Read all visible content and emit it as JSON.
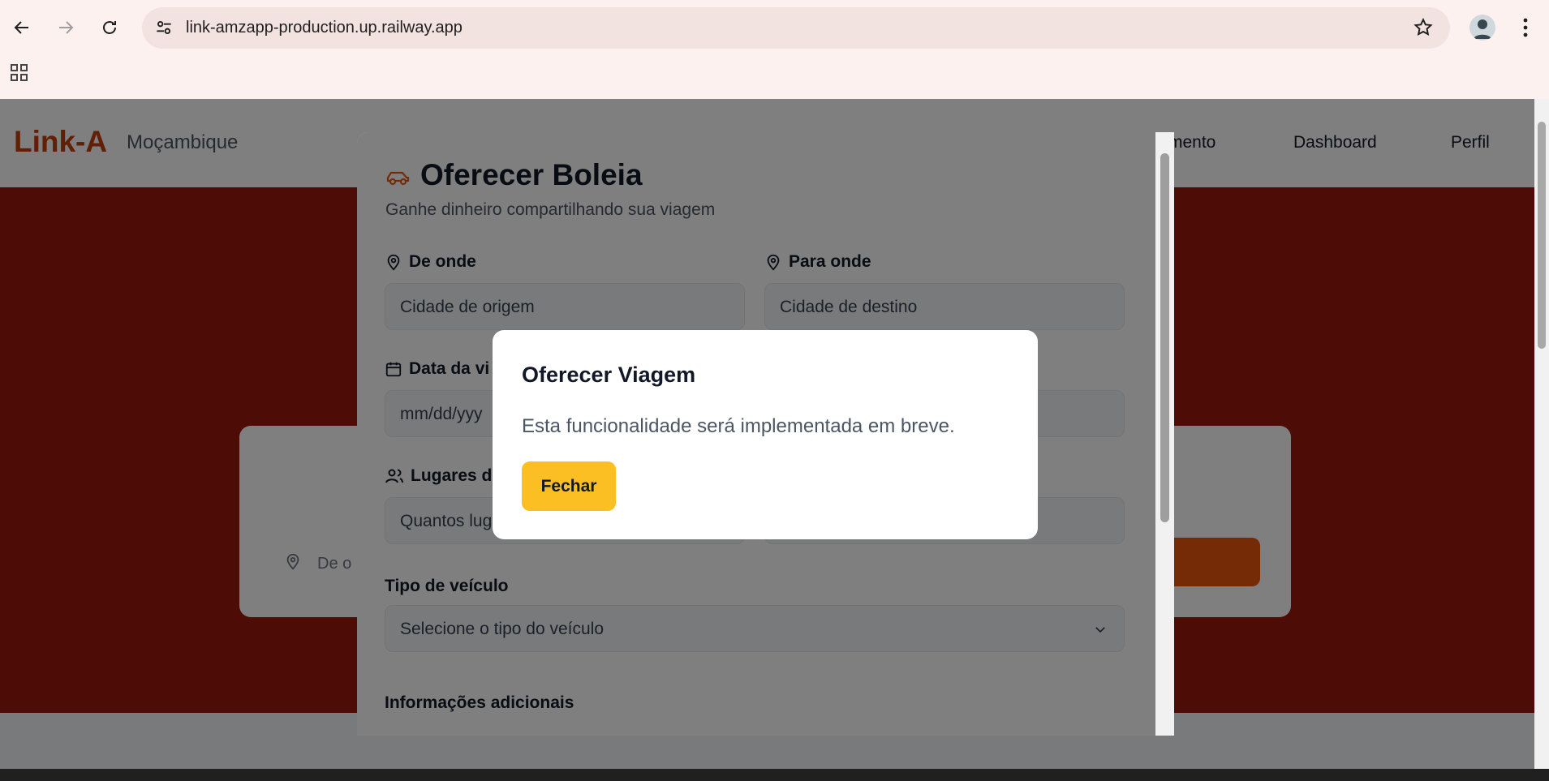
{
  "browser": {
    "url": "link-amzapp-production.up.railway.app"
  },
  "site": {
    "logo": "Link-A",
    "country": "Moçambique",
    "nav": [
      "mento",
      "Dashboard",
      "Perfil"
    ],
    "search_placeholder": "De o"
  },
  "form": {
    "title": "Oferecer Boleia",
    "subtitle": "Ganhe dinheiro compartilhando sua viagem",
    "from_label": "De onde",
    "from_placeholder": "Cidade de origem",
    "to_label": "Para onde",
    "to_placeholder": "Cidade de destino",
    "date_label": "Data da vi",
    "date_placeholder": "mm/dd/yyy",
    "seats_label": "Lugares d",
    "seats_placeholder": "Quantos lug",
    "vehicle_label": "Tipo de veículo",
    "vehicle_placeholder": "Selecione o tipo do veículo",
    "extra_label": "Informações adicionais"
  },
  "dialog": {
    "title": "Oferecer Viagem",
    "message": "Esta funcionalidade será implementada em breve.",
    "close_label": "Fechar"
  },
  "colors": {
    "brand": "#c2410c",
    "hero": "#9a1b0c",
    "button": "#fbbf24"
  }
}
